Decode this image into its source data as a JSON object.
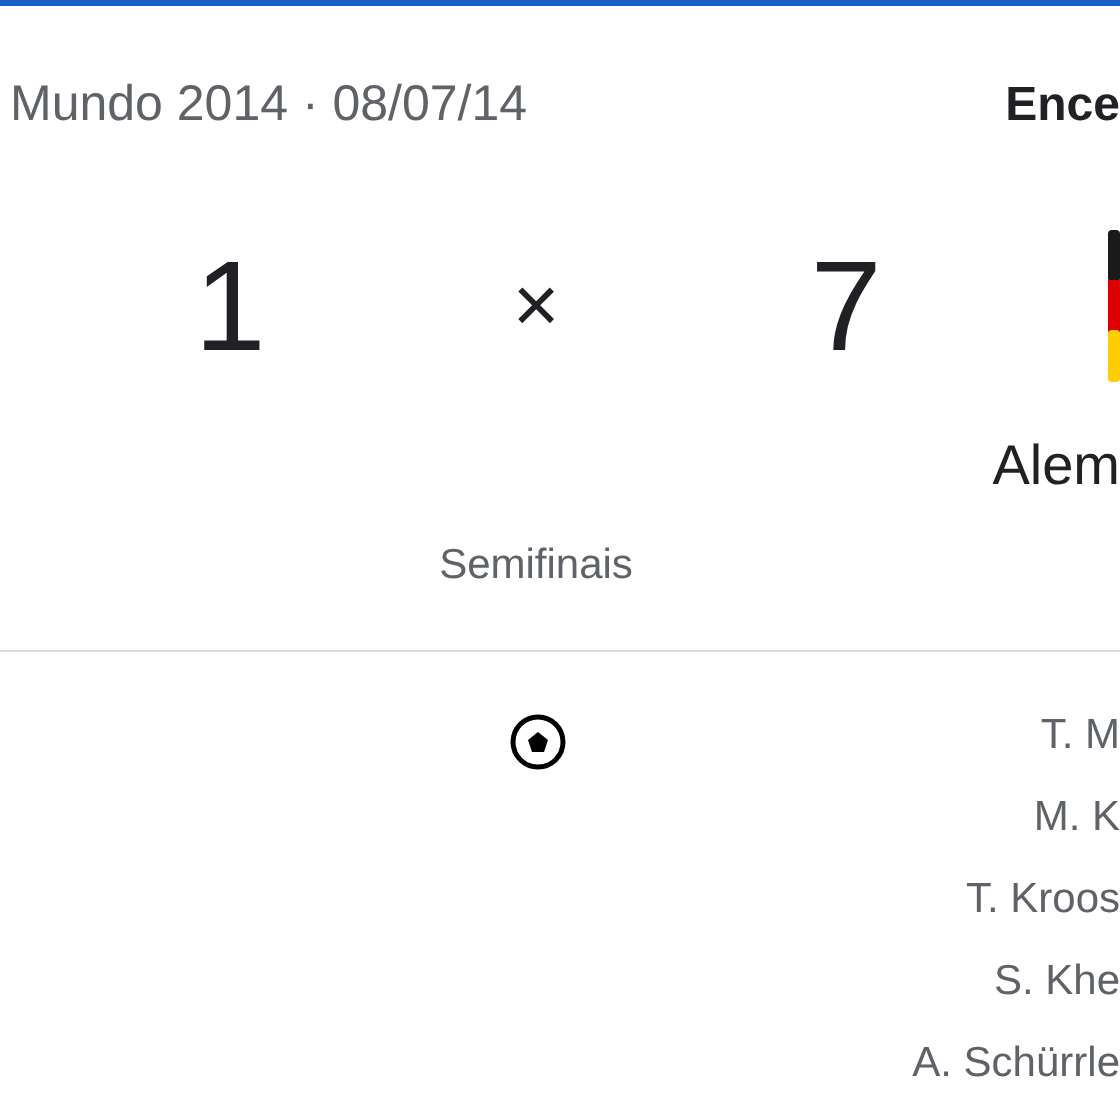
{
  "header": {
    "competition": "Mundo 2014 · 08/07/14",
    "status": "Ence"
  },
  "score": {
    "home": "1",
    "separator": "×",
    "away": "7"
  },
  "away_team": {
    "name": "Alem"
  },
  "stage": "Semifinais",
  "away_scorers": [
    "T. M",
    "M. K",
    "T. Kroos",
    "S. Khe",
    "A. Schürrle"
  ]
}
